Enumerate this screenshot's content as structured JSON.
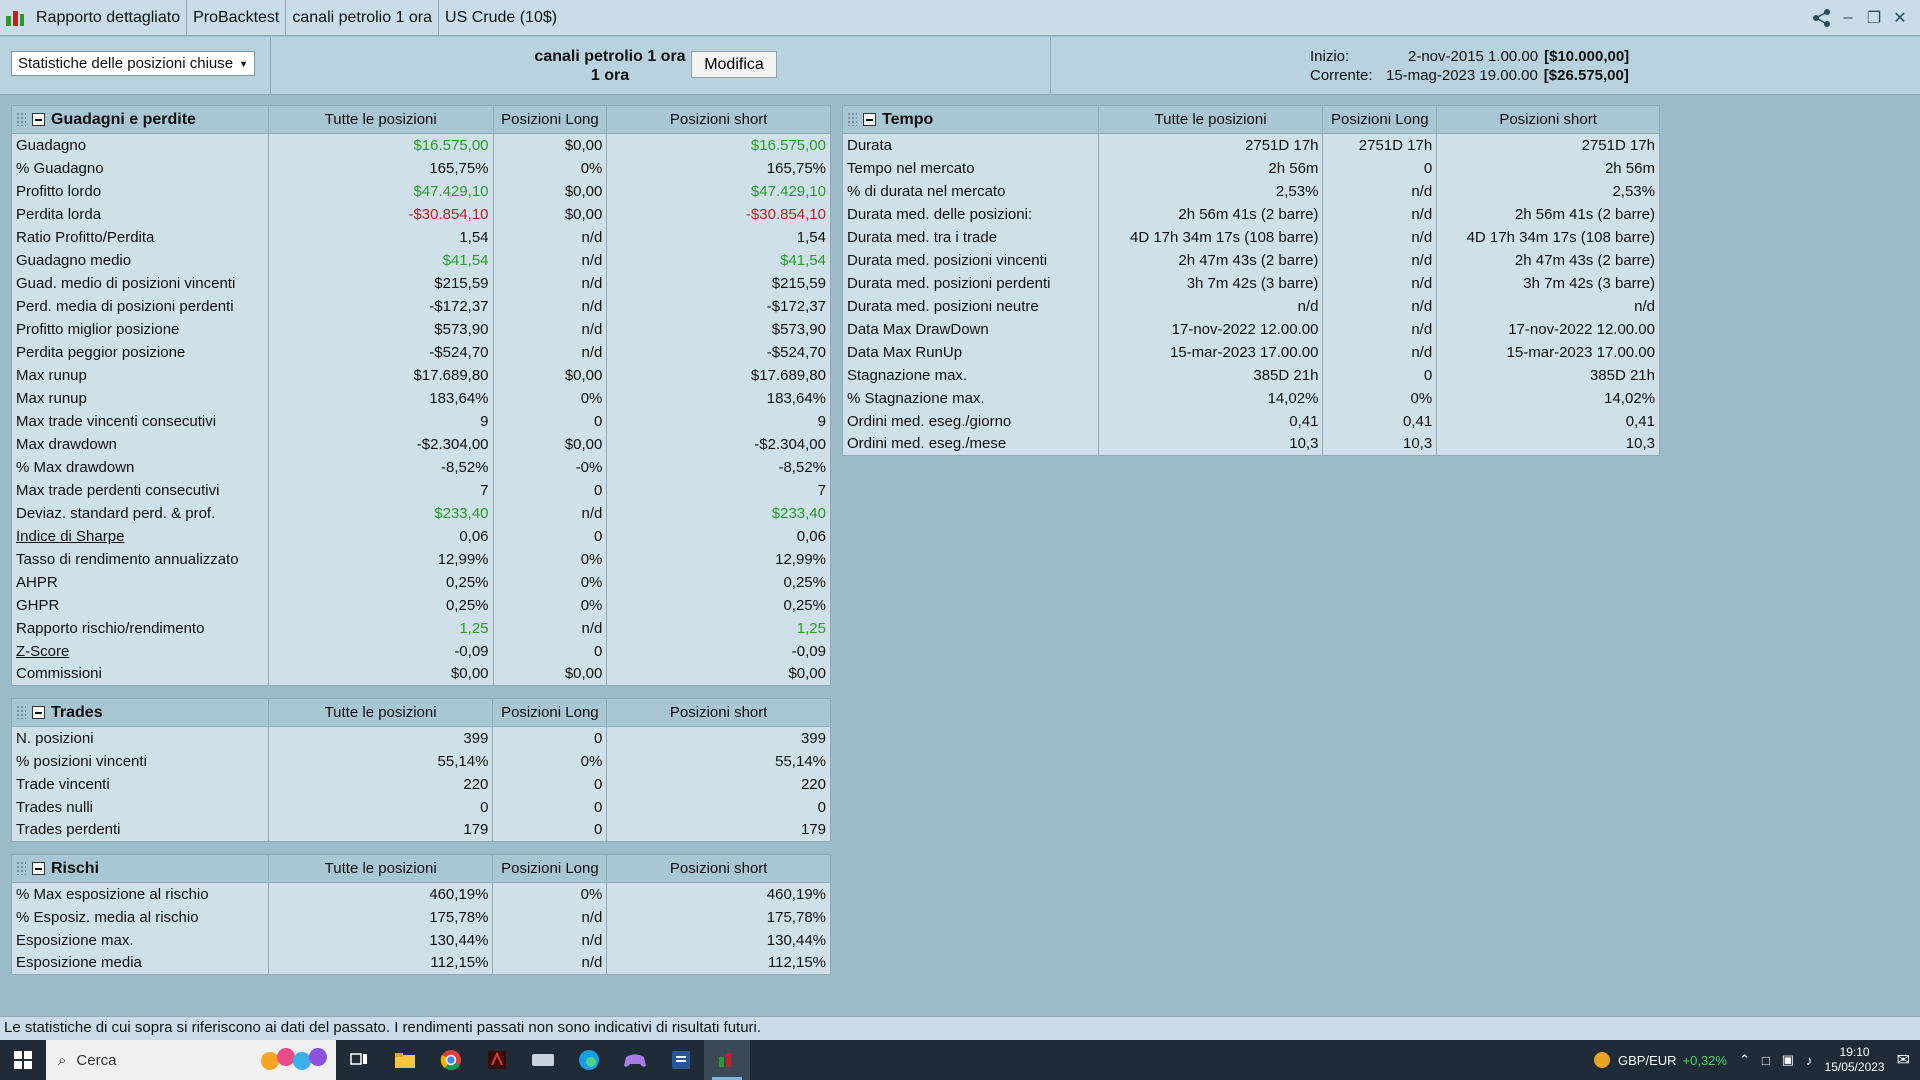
{
  "titlebar": {
    "segments": [
      "Rapporto dettagliato",
      "ProBacktest",
      "canali petrolio 1 ora",
      "US Crude (10$)"
    ]
  },
  "header": {
    "selector": "Statistiche delle posizioni chiuse",
    "strategy_line1": "canali petrolio 1 ora",
    "strategy_line2": "1 ora",
    "modify_label": "Modifica",
    "start_label": "Inizio:",
    "start_value": "2-nov-2015 1.00.00",
    "start_capital": "[$10.000,00]",
    "current_label": "Corrente:",
    "current_value": "15-mag-2023 19.00.00",
    "current_capital": "[$26.575,00]"
  },
  "columns": [
    "Tutte le posizioni",
    "Posizioni Long",
    "Posizioni short"
  ],
  "gains": {
    "title": "Guadagni e perdite",
    "rows": [
      [
        "Guadagno",
        "$16.575,00",
        "$0,00",
        "$16.575,00"
      ],
      [
        "% Guadagno",
        "165,75%",
        "0%",
        "165,75%"
      ],
      [
        "Profitto lordo",
        "$47.429,10",
        "$0,00",
        "$47.429,10"
      ],
      [
        "Perdita lorda",
        "-$30.854,10",
        "$0,00",
        "-$30.854,10"
      ],
      [
        "Ratio Profitto/Perdita",
        "1,54",
        "n/d",
        "1,54"
      ],
      [
        "Guadagno medio",
        "$41,54",
        "n/d",
        "$41,54"
      ],
      [
        "Guad. medio di posizioni vincenti",
        "$215,59",
        "n/d",
        "$215,59"
      ],
      [
        "Perd. media di posizioni perdenti",
        "-$172,37",
        "n/d",
        "-$172,37"
      ],
      [
        "Profitto miglior posizione",
        "$573,90",
        "n/d",
        "$573,90"
      ],
      [
        "Perdita peggior posizione",
        "-$524,70",
        "n/d",
        "-$524,70"
      ],
      [
        "Max runup",
        "$17.689,80",
        "$0,00",
        "$17.689,80"
      ],
      [
        "Max runup",
        "183,64%",
        "0%",
        "183,64%"
      ],
      [
        "Max trade vincenti consecutivi",
        "9",
        "0",
        "9"
      ],
      [
        "Max drawdown",
        "-$2.304,00",
        "$0,00",
        "-$2.304,00"
      ],
      [
        "% Max drawdown",
        "-8,52%",
        "-0%",
        "-8,52%"
      ],
      [
        "Max trade perdenti consecutivi",
        "7",
        "0",
        "7"
      ],
      [
        "Deviaz. standard perd. & prof.",
        "$233,40",
        "n/d",
        "$233,40"
      ],
      [
        "Indice di Sharpe",
        "0,06",
        "0",
        "0,06"
      ],
      [
        "Tasso di rendimento annualizzato",
        "12,99%",
        "0%",
        "12,99%"
      ],
      [
        "AHPR",
        "0,25%",
        "0%",
        "0,25%"
      ],
      [
        "GHPR",
        "0,25%",
        "0%",
        "0,25%"
      ],
      [
        "Rapporto rischio/rendimento",
        "1,25",
        "n/d",
        "1,25"
      ],
      [
        "Z-Score",
        "-0,09",
        "0",
        "-0,09"
      ],
      [
        "Commissioni",
        "$0,00",
        "$0,00",
        "$0,00"
      ]
    ]
  },
  "trades": {
    "title": "Trades",
    "rows": [
      [
        "N. posizioni",
        "399",
        "0",
        "399"
      ],
      [
        "% posizioni vincenti",
        "55,14%",
        "0%",
        "55,14%"
      ],
      [
        "Trade vincenti",
        "220",
        "0",
        "220"
      ],
      [
        "Trades nulli",
        "0",
        "0",
        "0"
      ],
      [
        "Trades perdenti",
        "179",
        "0",
        "179"
      ]
    ]
  },
  "risks": {
    "title": "Rischi",
    "rows": [
      [
        "% Max esposizione al rischio",
        "460,19%",
        "0%",
        "460,19%"
      ],
      [
        "% Esposiz. media al rischio",
        "175,78%",
        "n/d",
        "175,78%"
      ],
      [
        "Esposizione max.",
        "130,44%",
        "n/d",
        "130,44%"
      ],
      [
        "Esposizione media",
        "112,15%",
        "n/d",
        "112,15%"
      ]
    ]
  },
  "time": {
    "title": "Tempo",
    "rows": [
      [
        "Durata",
        "2751D 17h",
        "2751D 17h",
        "2751D 17h"
      ],
      [
        "Tempo nel mercato",
        "2h 56m",
        "0",
        "2h 56m"
      ],
      [
        "% di durata nel mercato",
        "2,53%",
        "n/d",
        "2,53%"
      ],
      [
        "Durata med. delle posizioni:",
        "2h 56m 41s (2 barre)",
        "n/d",
        "2h 56m 41s (2 barre)"
      ],
      [
        "Durata med. tra i trade",
        "4D 17h 34m 17s (108 barre)",
        "n/d",
        "4D 17h 34m 17s (108 barre)"
      ],
      [
        "Durata med. posizioni vincenti",
        "2h 47m 43s (2 barre)",
        "n/d",
        "2h 47m 43s (2 barre)"
      ],
      [
        "Durata med. posizioni perdenti",
        "3h 7m 42s (3 barre)",
        "n/d",
        "3h 7m 42s (3 barre)"
      ],
      [
        "Durata med. posizioni neutre",
        "n/d",
        "n/d",
        "n/d"
      ],
      [
        "Data Max DrawDown",
        "17-nov-2022 12.00.00",
        "n/d",
        "17-nov-2022 12.00.00"
      ],
      [
        "Data Max RunUp",
        "15-mar-2023 17.00.00",
        "n/d",
        "15-mar-2023 17.00.00"
      ],
      [
        "Stagnazione max.",
        "385D 21h",
        "0",
        "385D 21h"
      ],
      [
        "% Stagnazione max.",
        "14,02%",
        "0%",
        "14,02%"
      ],
      [
        "Ordini med. eseg./giorno",
        "0,41",
        "0,41",
        "0,41"
      ],
      [
        "Ordini med. eseg./mese",
        "10,3",
        "10,3",
        "10,3"
      ]
    ]
  },
  "footer": "Le statistiche di cui sopra si riferiscono ai dati del passato. I rendimenti passati non sono indicativi di risultati futuri.",
  "taskbar": {
    "search_label": "Cerca",
    "ticker_name": "GBP/EUR",
    "ticker_change": "+0,32%",
    "time": "19:10",
    "date": "15/05/2023"
  },
  "colors": {
    "positive": "#2a9a2a",
    "negative": "#c0202a",
    "panel": "#9dbccb"
  }
}
